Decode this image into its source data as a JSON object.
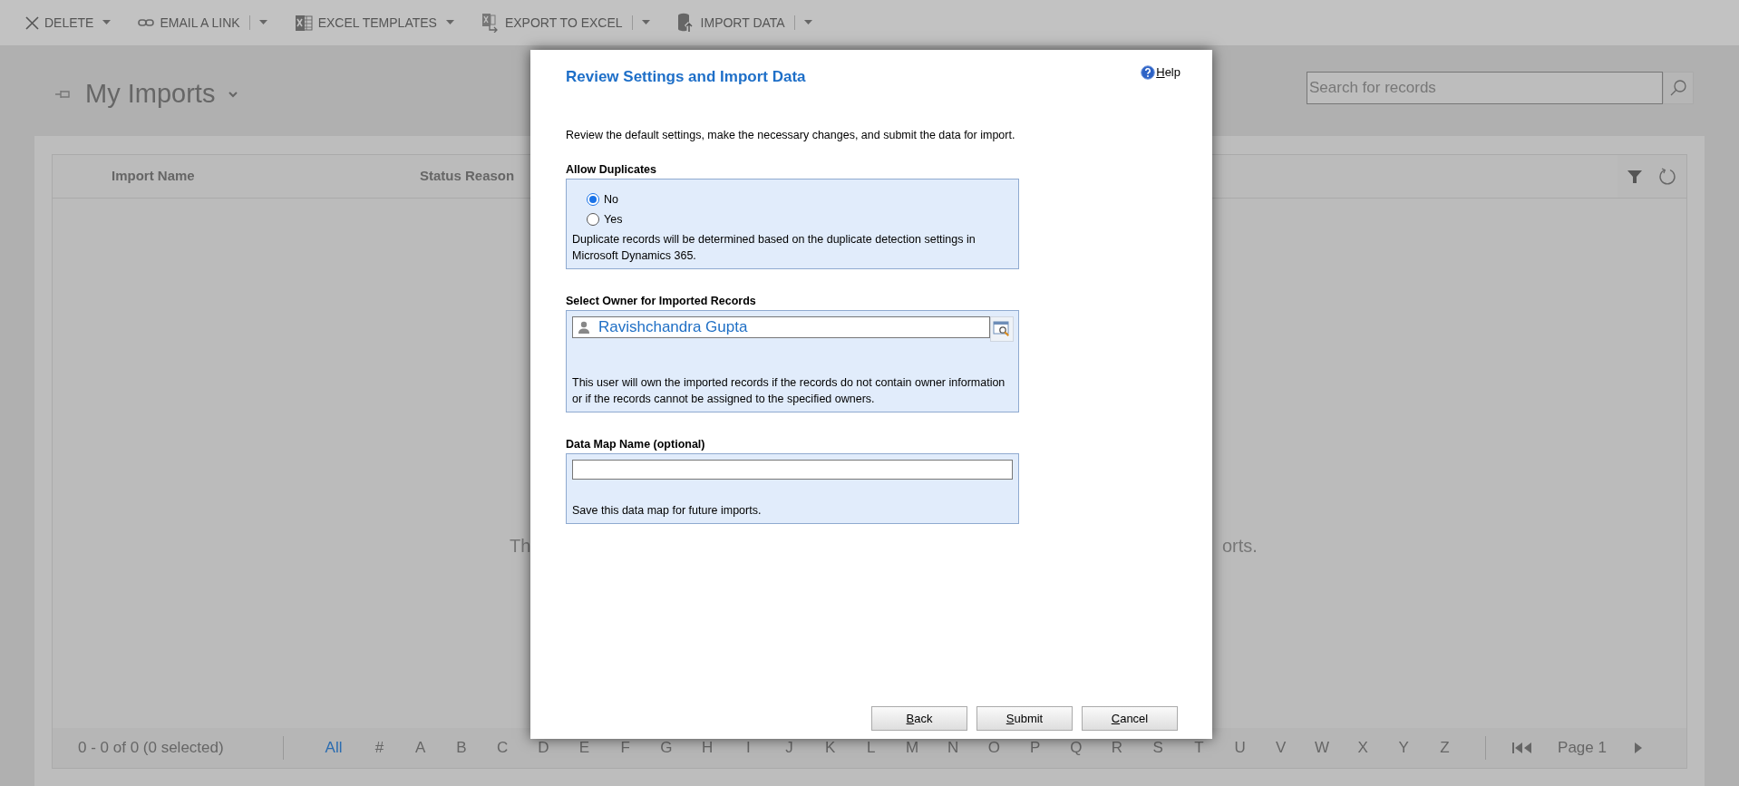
{
  "toolbar": {
    "buttons": [
      {
        "label": "DELETE",
        "kind": "dropdown"
      },
      {
        "label": "EMAIL A LINK",
        "kind": "split"
      },
      {
        "label": "EXCEL TEMPLATES",
        "kind": "dropdown"
      },
      {
        "label": "EXPORT TO EXCEL",
        "kind": "split"
      },
      {
        "label": "IMPORT DATA",
        "kind": "split"
      }
    ]
  },
  "view": {
    "title": "My Imports",
    "search": {
      "placeholder": "Search for records"
    }
  },
  "grid": {
    "columns": [
      "Import Name",
      "Status Reason"
    ],
    "empty_message_left": "Th",
    "empty_message_right": "orts."
  },
  "footer": {
    "record_count": "0 - 0 of 0 (0 selected)",
    "letters": [
      {
        "label": "All",
        "selected": true
      },
      {
        "label": "#",
        "selected": false
      },
      {
        "label": "A",
        "selected": false
      },
      {
        "label": "B",
        "selected": false
      },
      {
        "label": "C",
        "selected": false
      },
      {
        "label": "D",
        "selected": false
      },
      {
        "label": "E",
        "selected": false
      },
      {
        "label": "F",
        "selected": false
      },
      {
        "label": "G",
        "selected": false
      },
      {
        "label": "H",
        "selected": false
      },
      {
        "label": "I",
        "selected": false
      },
      {
        "label": "J",
        "selected": false
      },
      {
        "label": "K",
        "selected": false
      },
      {
        "label": "L",
        "selected": false
      },
      {
        "label": "M",
        "selected": false
      },
      {
        "label": "N",
        "selected": false
      },
      {
        "label": "O",
        "selected": false
      },
      {
        "label": "P",
        "selected": false
      },
      {
        "label": "Q",
        "selected": false
      },
      {
        "label": "R",
        "selected": false
      },
      {
        "label": "S",
        "selected": false
      },
      {
        "label": "T",
        "selected": false
      },
      {
        "label": "U",
        "selected": false
      },
      {
        "label": "V",
        "selected": false
      },
      {
        "label": "W",
        "selected": false
      },
      {
        "label": "X",
        "selected": false
      },
      {
        "label": "Y",
        "selected": false
      },
      {
        "label": "Z",
        "selected": false
      }
    ],
    "page": "Page 1"
  },
  "dialog": {
    "title": "Review Settings and Import Data",
    "help": "Help",
    "description": "Review the default settings, make the necessary changes, and submit the data for import.",
    "sections": [
      {
        "label": "Allow Duplicates",
        "kind": "radio",
        "options": [
          {
            "label": "No",
            "selected": true
          },
          {
            "label": "Yes",
            "selected": false
          }
        ],
        "note": "Duplicate records will be determined based on the duplicate detection settings in Microsoft Dynamics 365."
      },
      {
        "label": "Select Owner for Imported Records",
        "kind": "lookup",
        "value": "Ravishchandra Gupta",
        "note": "This user will own the imported records if the records do not contain owner information or if the records cannot be assigned to the specified owners."
      },
      {
        "label": "Data Map Name (optional)",
        "kind": "text",
        "note": "Save this data map for future imports."
      }
    ],
    "buttons": [
      "Back",
      "Submit",
      "Cancel"
    ]
  }
}
